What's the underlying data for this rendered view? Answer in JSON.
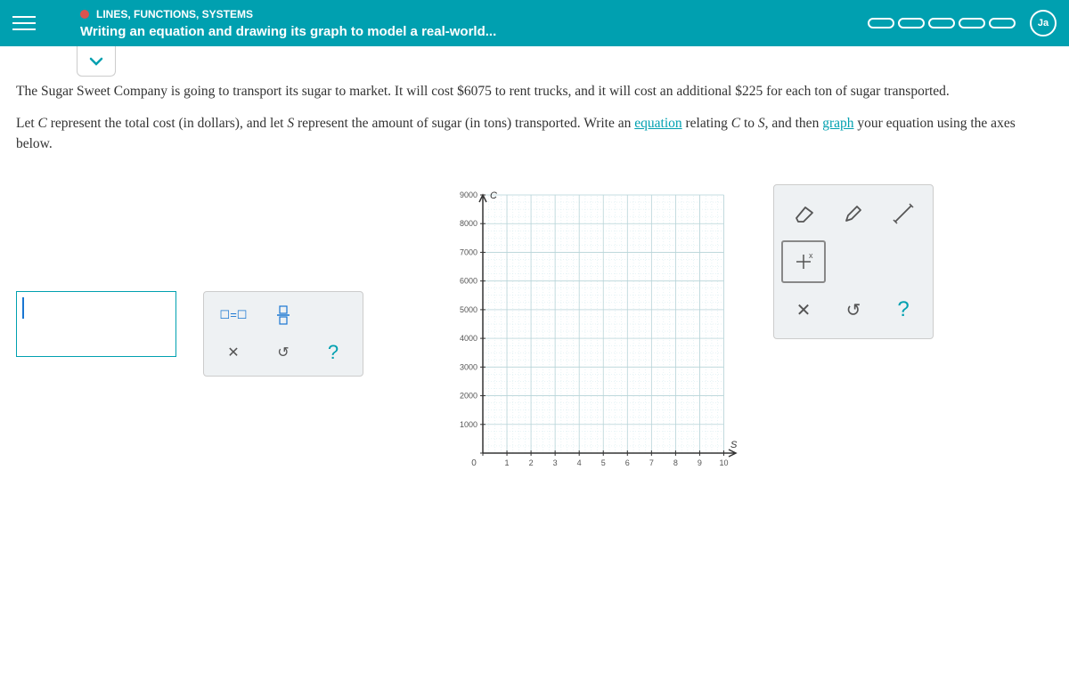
{
  "header": {
    "category": "LINES, FUNCTIONS, SYSTEMS",
    "title": "Writing an equation and drawing its graph to model a real-world...",
    "user_initials": "Ja"
  },
  "problem": {
    "p1_a": "The Sugar Sweet Company is going to transport its sugar to market. It will cost ",
    "p1_cost1": "$6075",
    "p1_b": " to rent trucks, and it will cost an additional ",
    "p1_cost2": "$225",
    "p1_c": " for each ton of sugar transported.",
    "p2_a": "Let ",
    "p2_var1": "C",
    "p2_b": " represent the total cost (in dollars), and let ",
    "p2_var2": "S",
    "p2_c": " represent the amount of sugar (in tons) transported. Write an ",
    "p2_link1": "equation",
    "p2_d": " relating ",
    "p2_var3": "C",
    "p2_e": " to ",
    "p2_var4": "S",
    "p2_f": ", and then ",
    "p2_link2": "graph",
    "p2_g": " your equation using the axes below."
  },
  "eq_palette": {
    "equals": "☐=☐",
    "fraction": "☐/☐",
    "clear": "✕",
    "undo": "↺",
    "help": "?"
  },
  "graph_palette": {
    "eraser": "eraser-icon",
    "pencil": "pencil-icon",
    "line": "line-icon",
    "point": "point-icon",
    "clear": "✕",
    "undo": "↺",
    "help": "?"
  },
  "chart_data": {
    "type": "scatter",
    "title": "",
    "xlabel": "S",
    "ylabel": "C",
    "x_ticks": [
      0,
      1,
      2,
      3,
      4,
      5,
      6,
      7,
      8,
      9,
      10
    ],
    "y_ticks": [
      0,
      1000,
      2000,
      3000,
      4000,
      5000,
      6000,
      7000,
      8000,
      9000
    ],
    "xlim": [
      0,
      10.5
    ],
    "ylim": [
      0,
      9000
    ],
    "series": []
  }
}
